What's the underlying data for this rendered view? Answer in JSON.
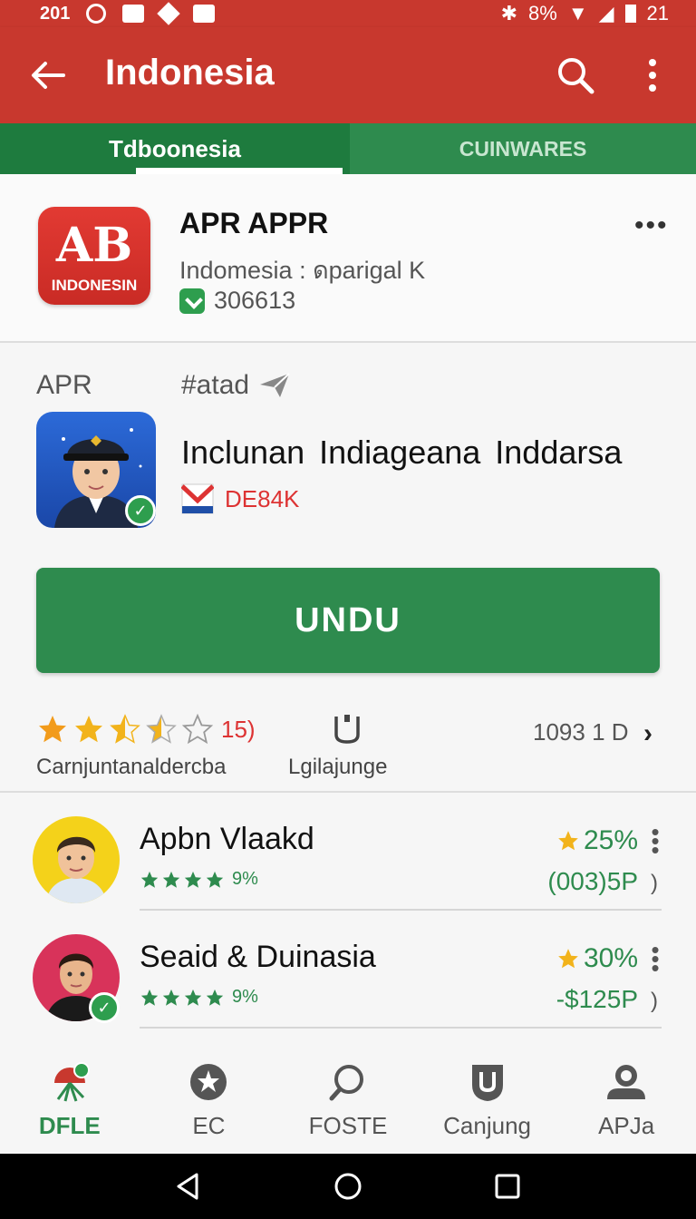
{
  "status_bar": {
    "time_left": "201",
    "battery": "8%",
    "clock": "21"
  },
  "app_bar": {
    "title": "Indonesia"
  },
  "tabs": [
    {
      "label": "Tdboonesia",
      "active": true
    },
    {
      "label": "CUINWARES",
      "active": false
    }
  ],
  "featured_app": {
    "icon_big": "AB",
    "icon_small": "INDONESIN",
    "name": "APR APPR",
    "subtitle": "Indomesia : ดparigal K",
    "downloads": "306613"
  },
  "detail": {
    "label": "APR",
    "status": "#atad",
    "headline": "Inclunan Indiageana Inddarsa",
    "developer": "DE84K",
    "install_label": "UNDU",
    "rating": 3.5,
    "rating_count": "15)",
    "rating_label": "Carnjuntanaldercba",
    "tag_label": "Lgilajunge",
    "size": "1093 1 D"
  },
  "reviews": [
    {
      "name": "Apbn Vlaakd",
      "stars_label": "9%",
      "percent": "25%",
      "price": "(003)5P",
      "paren": ")",
      "stars": 4
    },
    {
      "name": "Seaid & Duinasia",
      "stars_label": "9%",
      "percent": "30%",
      "price": "-$125P",
      "paren": ")",
      "stars": 4
    }
  ],
  "bottom_nav": [
    {
      "label": "DFLE",
      "icon": "app-icon",
      "active": true
    },
    {
      "label": "EC",
      "icon": "badge-icon",
      "active": false
    },
    {
      "label": "FOSTE",
      "icon": "search-icon",
      "active": false
    },
    {
      "label": "Canjung",
      "icon": "shield-icon",
      "active": false
    },
    {
      "label": "APJa",
      "icon": "person-icon",
      "active": false
    }
  ],
  "colors": {
    "primary_red": "#c8382e",
    "primary_green": "#2e8b4e",
    "star_orange": "#f29b1b"
  }
}
